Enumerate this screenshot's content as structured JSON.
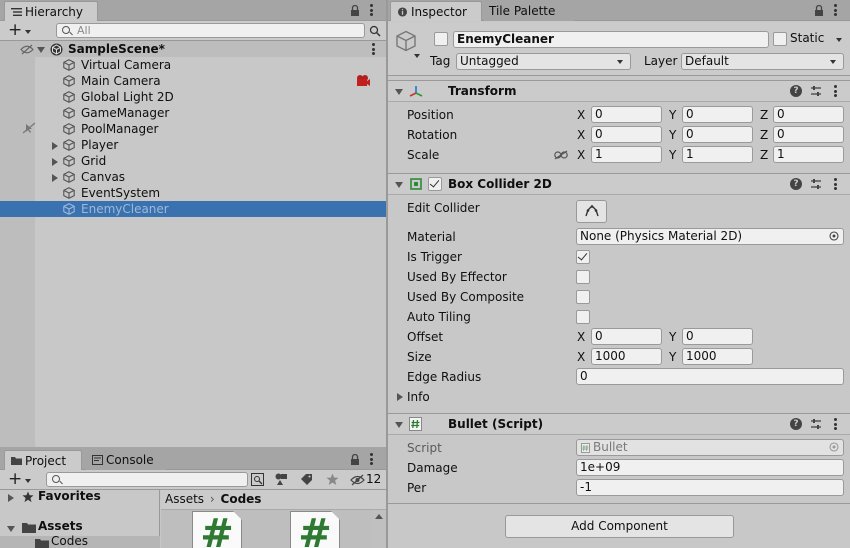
{
  "hierarchy": {
    "tab_label": "Hierarchy",
    "search_placeholder": "All",
    "scene_name": "SampleScene*",
    "items": [
      {
        "label": "Virtual Camera",
        "foldout": false,
        "selected": false
      },
      {
        "label": "Main Camera",
        "foldout": false,
        "selected": false
      },
      {
        "label": "Global Light 2D",
        "foldout": false,
        "selected": false
      },
      {
        "label": "GameManager",
        "foldout": false,
        "selected": false
      },
      {
        "label": "PoolManager",
        "foldout": false,
        "selected": false
      },
      {
        "label": "Player",
        "foldout": true,
        "selected": false
      },
      {
        "label": "Grid",
        "foldout": true,
        "selected": false
      },
      {
        "label": "Canvas",
        "foldout": true,
        "selected": false
      },
      {
        "label": "EventSystem",
        "foldout": false,
        "selected": false
      },
      {
        "label": "EnemyCleaner",
        "foldout": false,
        "selected": true
      }
    ]
  },
  "project": {
    "tab_label": "Project",
    "console_tab_label": "Console",
    "hidden_count": "12",
    "favorites_label": "Favorites",
    "assets_label": "Assets",
    "codes_label": "Codes",
    "breadcrumb": [
      "Assets",
      "Codes"
    ],
    "file_glyph": "#"
  },
  "inspector": {
    "tab_label": "Inspector",
    "tile_palette_tab_label": "Tile Palette",
    "object_name": "EnemyCleaner",
    "static_label": "Static",
    "tag_label": "Tag",
    "tag_value": "Untagged",
    "layer_label": "Layer",
    "layer_value": "Default",
    "transform": {
      "title": "Transform",
      "position_label": "Position",
      "rotation_label": "Rotation",
      "scale_label": "Scale",
      "position": {
        "x": "0",
        "y": "0",
        "z": "0"
      },
      "rotation": {
        "x": "0",
        "y": "0",
        "z": "0"
      },
      "scale": {
        "x": "1",
        "y": "1",
        "z": "1"
      }
    },
    "box_collider": {
      "title": "Box Collider 2D",
      "enabled": true,
      "edit_collider_label": "Edit Collider",
      "material_label": "Material",
      "material_value": "None (Physics Material 2D)",
      "is_trigger_label": "Is Trigger",
      "is_trigger": true,
      "used_by_effector_label": "Used By Effector",
      "used_by_effector": false,
      "used_by_composite_label": "Used By Composite",
      "used_by_composite": false,
      "auto_tiling_label": "Auto Tiling",
      "auto_tiling": false,
      "offset_label": "Offset",
      "offset": {
        "x": "0",
        "y": "0"
      },
      "size_label": "Size",
      "size": {
        "x": "1000",
        "y": "1000"
      },
      "edge_radius_label": "Edge Radius",
      "edge_radius": "0",
      "info_label": "Info"
    },
    "bullet_script": {
      "title": "Bullet (Script)",
      "script_label": "Script",
      "script_value": "Bullet",
      "damage_label": "Damage",
      "damage_value": "1e+09",
      "per_label": "Per",
      "per_value": "-1"
    },
    "add_component_label": "Add Component",
    "axis_labels": {
      "x": "X",
      "y": "Y",
      "z": "Z"
    }
  },
  "colors": {
    "selection": "#3a72b0",
    "script_hash": "#2e7a33",
    "collider_icon": "#2e8b3a"
  }
}
